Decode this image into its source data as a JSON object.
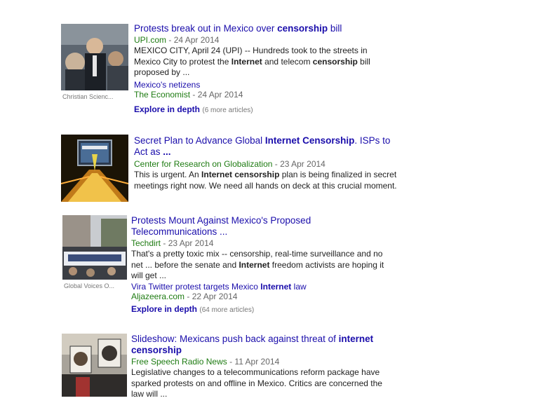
{
  "results": [
    {
      "title_pre": "Protests break out in Mexico over ",
      "title_bold": "censorship",
      "title_post": " bill",
      "site": "UPI.com",
      "date": "- 24 Apr 2014",
      "snippet_1": "MEXICO CITY, April 24 (UPI) -- Hundreds took to the streets in Mexico City to protest the ",
      "snippet_b1": "Internet",
      "snippet_2": " and telecom ",
      "snippet_b2": "censorship",
      "snippet_3": " bill proposed by ...",
      "image_credit": "Christian Scienc...",
      "related_title": "Mexico's netizens",
      "related_site": "The Economist",
      "related_date": "- 24 Apr 2014",
      "explore_label": "Explore in depth",
      "explore_count": "(6 more articles)"
    },
    {
      "title_pre": "Secret Plan to Advance Global ",
      "title_bold": "Internet Censorship",
      "title_post": ". ISPs to Act as ",
      "title_end": "...",
      "site": "Center for Research on Globalization",
      "date": "- 23 Apr 2014",
      "snippet_1": "This is urgent. An ",
      "snippet_b1": "Internet censorship",
      "snippet_2": " plan is being finalized in secret meetings right now. We need all hands on deck at this crucial moment."
    },
    {
      "title": "Protests Mount Against Mexico's Proposed Telecommunications ...",
      "site": "Techdirt",
      "date": "- 23 Apr 2014",
      "snippet_1": "That's a pretty toxic mix -- censorship, real-time surveillance and no net ... before the senate and ",
      "snippet_b1": "Internet",
      "snippet_2": " freedom activists are hoping it will get ...",
      "image_credit": "Global Voices O...",
      "related_pre": "Vira Twitter protest targets Mexico ",
      "related_bold": "Internet",
      "related_post": " law",
      "related_site": "Aljazeera.com",
      "related_date": "- 22 Apr 2014",
      "explore_label": "Explore in depth",
      "explore_count": "(64 more articles)"
    },
    {
      "title_pre": "Slideshow: Mexicans push back against threat of ",
      "title_bold": "internet censorship",
      "site": "Free Speech Radio News",
      "date": "- 11 Apr 2014",
      "snippet_1": "Legislative changes to a telecommunications reform package have sparked protests on and offline in Mexico. Critics are concerned the law will ..."
    }
  ],
  "colors": {
    "link": "#1a0dab",
    "site": "#1e7b12",
    "meta": "#666666"
  }
}
